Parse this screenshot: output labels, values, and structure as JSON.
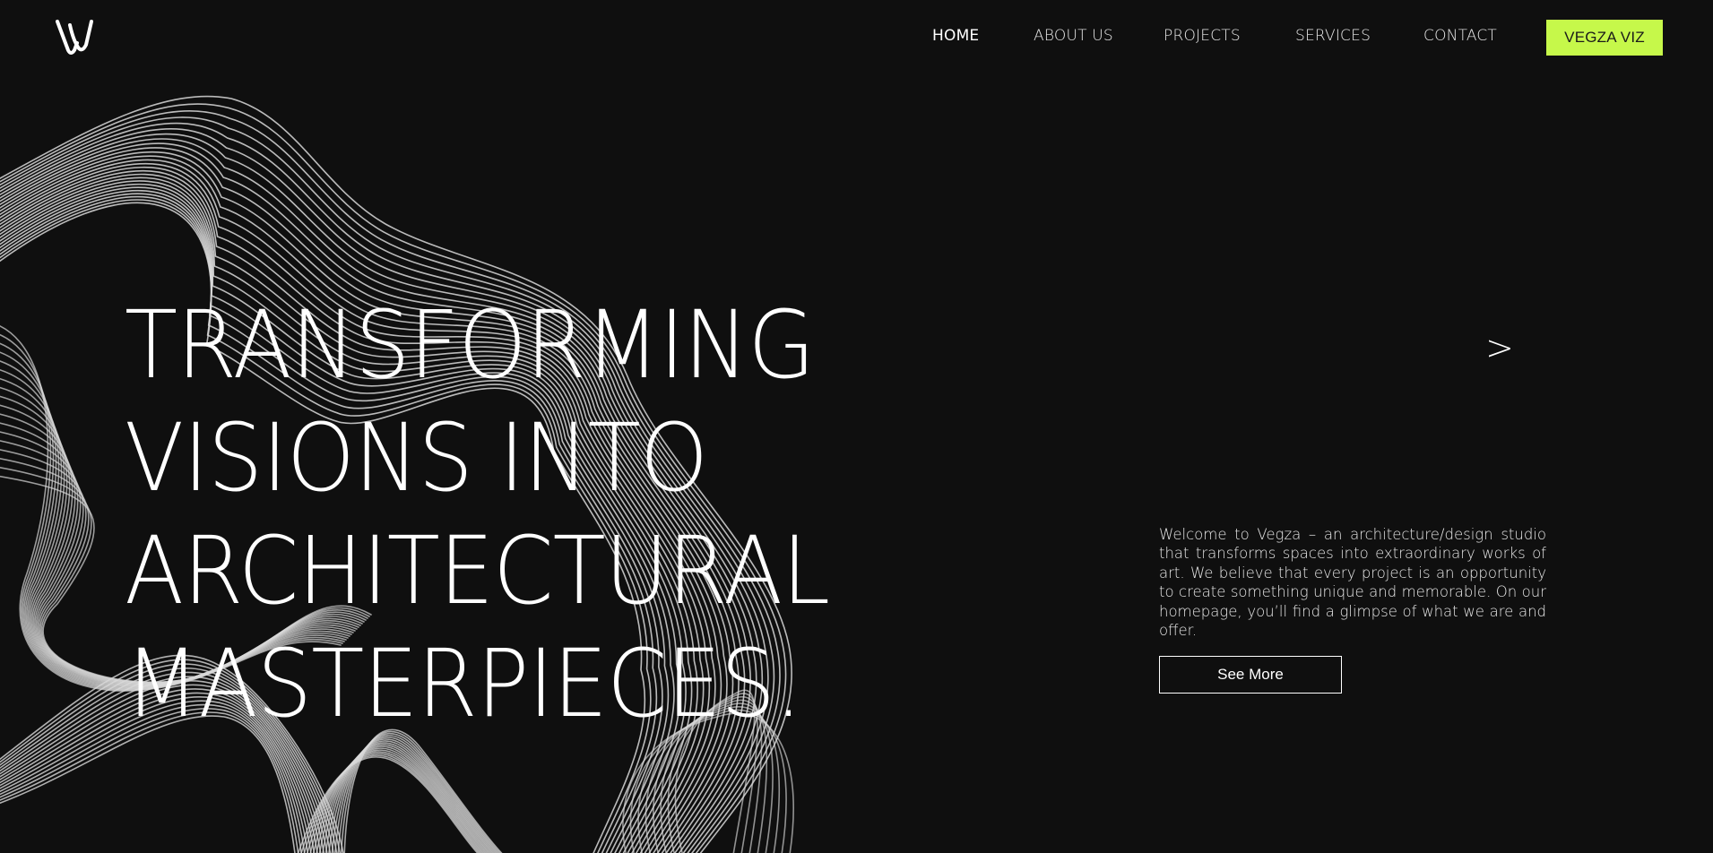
{
  "brand": {
    "logo_icon": "vegza-v-logo-icon",
    "accent_color": "#c6f84a",
    "background_color": "#0f0f0f"
  },
  "nav": {
    "items": [
      {
        "label": "HOME",
        "active": true
      },
      {
        "label": "ABOUT US",
        "active": false
      },
      {
        "label": "PROJECTS",
        "active": false
      },
      {
        "label": "SERVICES",
        "active": false
      },
      {
        "label": "CONTACT",
        "active": false
      }
    ],
    "cta_label": "VEGZA VIZ"
  },
  "hero": {
    "title_lines": [
      "TRANSFORMING",
      "VISIONS INTO",
      "ARCHITECTURAL",
      "MASTERPIECES."
    ],
    "next_arrow": ">",
    "intro_text": "Welcome to Vegza – an architecture/design studio that transforms spaces into extraordinary works of art. We believe that every project is an opportunity to create something unique and memorable. On our homepage, you’ll find a glimpse of what we are and offer.",
    "button_label": "See More"
  }
}
